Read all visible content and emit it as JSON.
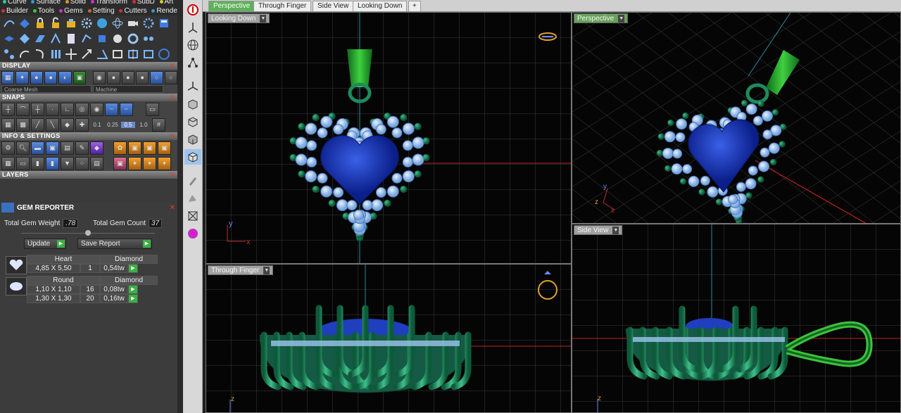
{
  "menu": {
    "row1": [
      "Curve",
      "Surface",
      "Solid",
      "Transform",
      "SubD",
      "Art"
    ],
    "row2": [
      "Builder",
      "Tools",
      "Gems",
      "Setting",
      "Cutters",
      "Render"
    ]
  },
  "sections": {
    "display": "DISPLAY",
    "snaps": "SNAPS",
    "info": "INFO & SETTINGS",
    "layers": "LAYERS"
  },
  "display": {
    "mesh_select": "Coarse Mesh",
    "material_select": "Machine"
  },
  "snaps": {
    "values": [
      "0.1",
      "0.25",
      "0.5",
      "1.0"
    ],
    "active_index": 2
  },
  "gem_reporter": {
    "title": "GEM REPORTER",
    "total_weight_label": "Total Gem Weight",
    "total_weight": ".78",
    "total_count_label": "Total Gem Count",
    "total_count": "37",
    "update_label": "Update",
    "save_report_label": "Save Report",
    "groups": [
      {
        "shape": "Heart",
        "material": "Diamond",
        "rows": [
          {
            "size": "4,85 X 5,50",
            "count": "1",
            "weight": "0,54tw"
          }
        ]
      },
      {
        "shape": "Round",
        "material": "Diamond",
        "rows": [
          {
            "size": "1,10 X 1,10",
            "count": "16",
            "weight": "0,08tw"
          },
          {
            "size": "1,30 X 1,30",
            "count": "20",
            "weight": "0,16tw"
          }
        ]
      }
    ]
  },
  "tabs": [
    "Perspective",
    "Through Finger",
    "Side View",
    "Looking Down",
    "+"
  ],
  "active_tab": "Perspective",
  "viewports": {
    "top_left": "Looking Down",
    "top_right": "Perspective",
    "bottom_left": "Through Finger",
    "bottom_right": "Side View"
  },
  "axes": {
    "x": "x",
    "y": "y",
    "z": "z"
  },
  "colors": {
    "accent_green": "#5fb05a",
    "gem_blue": "#1f3fbf",
    "metal_green": "#1f8a5c",
    "melee_light_blue": "#9cc4ef",
    "grid": "#3a3a3a"
  }
}
